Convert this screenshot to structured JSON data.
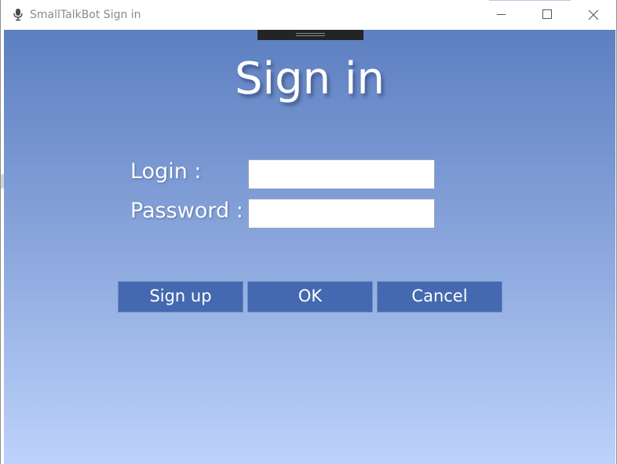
{
  "window": {
    "title": "SmallTalkBot Sign in",
    "app_icon": "microphone-icon",
    "controls": {
      "minimize": "minimize-icon",
      "maximize": "maximize-icon",
      "close": "close-icon"
    }
  },
  "form": {
    "heading": "Sign in",
    "login_label": "Login :",
    "login_value": "",
    "password_label": "Password :",
    "password_value": ""
  },
  "buttons": {
    "signup_label": "Sign up",
    "ok_label": "OK",
    "cancel_label": "Cancel"
  },
  "colors": {
    "gradient_top": "#5d7fc1",
    "gradient_bottom": "#bdd2fb",
    "button_fill": "#4469b0",
    "grip_bar": "#222426"
  }
}
